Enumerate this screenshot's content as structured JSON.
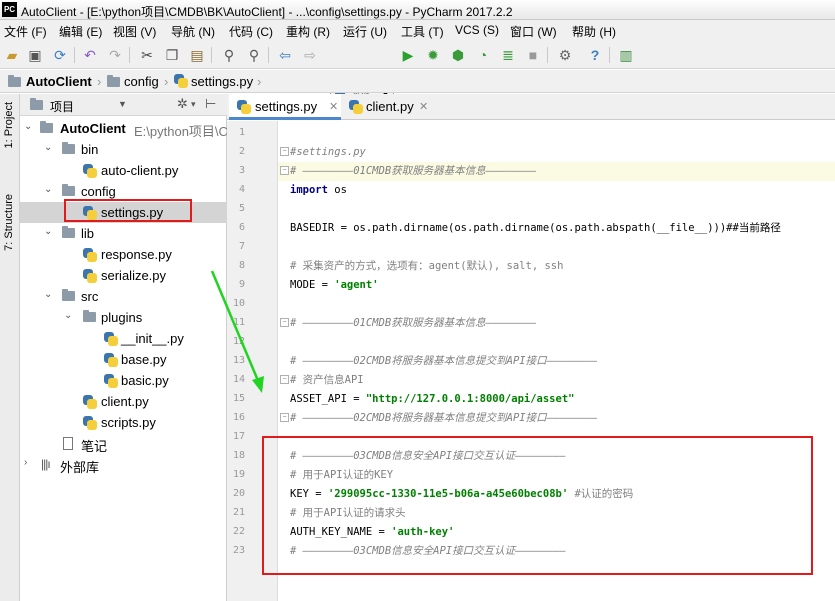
{
  "window": {
    "title": "AutoClient - [E:\\python项目\\CMDB\\BK\\AutoClient] - ...\\config\\settings.py - PyCharm 2017.2.2",
    "app_icon_text": "PC"
  },
  "menu": [
    "文件 (F)",
    "编辑 (E)",
    "视图 (V)",
    "导航 (N)",
    "代码 (C)",
    "重构 (R)",
    "运行 (U)",
    "工具 (T)",
    "VCS (S)",
    "窗口 (W)",
    "帮助 (H)"
  ],
  "toolbar": {
    "run_config": "run",
    "icons": [
      "open-icon",
      "save-icon",
      "sync-icon",
      "undo-icon",
      "redo-icon",
      "cut-icon",
      "copy-icon",
      "paste-icon",
      "find-icon",
      "replace-icon",
      "back-icon",
      "forward-icon",
      "run-icon",
      "debug-icon",
      "coverage-icon",
      "profile-icon",
      "concurrency-icon",
      "stop-icon",
      "settings-icon",
      "help-icon",
      "vcs-icon"
    ]
  },
  "breadcrumb": [
    "AutoClient",
    "config",
    "settings.py"
  ],
  "side_tabs": [
    "1: Project",
    "7: Structure"
  ],
  "project_panel": {
    "title": "项目",
    "tree": [
      {
        "label": "AutoClient",
        "path": "E:\\python项目\\C",
        "type": "root"
      },
      {
        "label": "bin",
        "type": "folder"
      },
      {
        "label": "auto-client.py",
        "type": "file"
      },
      {
        "label": "config",
        "type": "folder"
      },
      {
        "label": "settings.py",
        "type": "file"
      },
      {
        "label": "lib",
        "type": "folder"
      },
      {
        "label": "response.py",
        "type": "file"
      },
      {
        "label": "serialize.py",
        "type": "file"
      },
      {
        "label": "src",
        "type": "folder"
      },
      {
        "label": "plugins",
        "type": "folder"
      },
      {
        "label": "__init__.py",
        "type": "file"
      },
      {
        "label": "base.py",
        "type": "file"
      },
      {
        "label": "basic.py",
        "type": "file"
      },
      {
        "label": "client.py",
        "type": "file"
      },
      {
        "label": "scripts.py",
        "type": "file"
      },
      {
        "label": "笔记",
        "type": "notes"
      },
      {
        "label": "外部库",
        "type": "library"
      }
    ]
  },
  "editor_tabs": [
    {
      "label": "settings.py",
      "active": true
    },
    {
      "label": "client.py",
      "active": false
    }
  ],
  "line_numbers": [
    "1",
    "2",
    "3",
    "4",
    "5",
    "6",
    "7",
    "8",
    "9",
    "10",
    "11",
    "12",
    "13",
    "14",
    "15",
    "16",
    "17",
    "18",
    "19",
    "20",
    "21",
    "22",
    "23"
  ],
  "code_lines": [
    "",
    "#settings.py",
    "# ————————01CMDB获取服务器基本信息————————",
    "import os",
    "",
    "BASEDIR = os.path.dirname(os.path.dirname(os.path.abspath(__file__)))##当前路径",
    "",
    "# 采集资产的方式，选项有：agent(默认), salt, ssh",
    "MODE = 'agent'",
    "",
    "# ————————01CMDB获取服务器基本信息————————",
    "",
    "# ————————02CMDB将服务器基本信息提交到API接口————————",
    "# 资产信息API",
    "ASSET_API = \"http://127.0.0.1:8000/api/asset\"",
    "# ————————02CMDB将服务器基本信息提交到API接口————————",
    "",
    "# ————————03CMDB信息安全API接口交互认证————————",
    "# 用于API认证的KEY",
    "KEY = '299095cc-1330-11e5-b06a-a45e60bec08b' #认证的密码",
    "# 用于API认证的请求头",
    "AUTH_KEY_NAME = 'auth-key'",
    "# ————————03CMDB信息安全API接口交互认证————————"
  ],
  "code_parts": {
    "l4_kw": "import",
    "l4_rest": " os",
    "l9_a": "MODE = ",
    "l9_s": "'agent'",
    "l15_a": "ASSET_API = ",
    "l15_s": "\"http://127.0.0.1:8000/api/asset\"",
    "l20_a": "KEY = ",
    "l20_s": "'299095cc-1330-11e5-b06a-a45e60bec08b'",
    "l20_c": " #认证的密码",
    "l22_a": "AUTH_KEY_NAME = ",
    "l22_s": "'auth-key'"
  },
  "annotation_colors": {
    "red": "#e01b1b",
    "green": "#22d422"
  }
}
